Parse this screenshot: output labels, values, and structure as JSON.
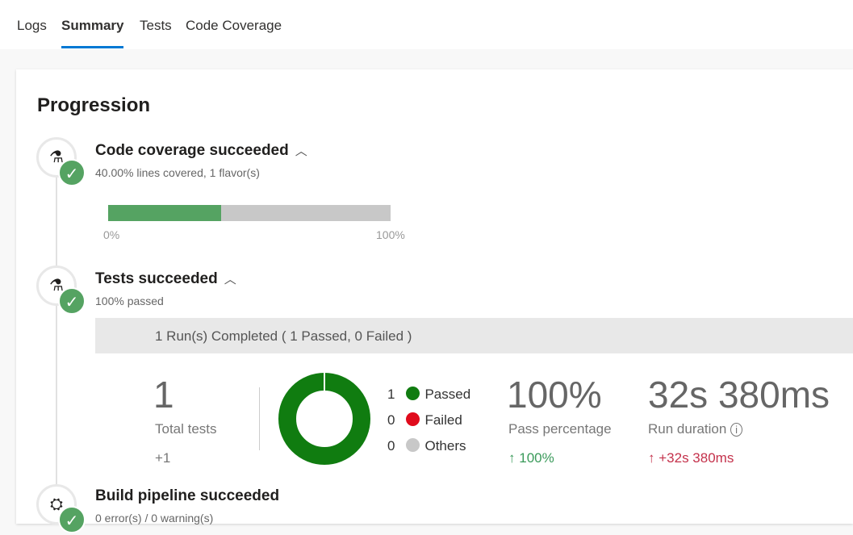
{
  "tabs": [
    {
      "label": "Logs"
    },
    {
      "label": "Summary",
      "active": true
    },
    {
      "label": "Tests"
    },
    {
      "label": "Code Coverage"
    }
  ],
  "title": "Progression",
  "coverage": {
    "title": "Code coverage succeeded",
    "subtitle": "40.00% lines covered, 1 flavor(s)",
    "percent": 40,
    "min_label": "0%",
    "max_label": "100%",
    "icon": "flask-icon"
  },
  "tests": {
    "title": "Tests succeeded",
    "subtitle": "100% passed",
    "run_summary": "1 Run(s) Completed ( 1 Passed, 0 Failed )",
    "total": "1",
    "total_label": "Total tests",
    "total_delta": "+1",
    "legend": [
      {
        "count": "1",
        "label": "Passed",
        "color": "#107c10"
      },
      {
        "count": "0",
        "label": "Failed",
        "color": "#e00b1c"
      },
      {
        "count": "0",
        "label": "Others",
        "color": "#c8c8c8"
      }
    ],
    "pass_pct": "100%",
    "pass_label": "Pass percentage",
    "pass_delta": "100%",
    "duration": "32s 380ms",
    "duration_label": "Run duration",
    "duration_delta": "+32s 380ms"
  },
  "build": {
    "title": "Build pipeline succeeded",
    "subtitle": "0 error(s) / 0 warning(s)",
    "icon": "build-icon"
  },
  "colors": {
    "accent": "#0078d4",
    "success": "#55a362",
    "up_green": "#3a9a5a",
    "up_red": "#c4314b"
  }
}
